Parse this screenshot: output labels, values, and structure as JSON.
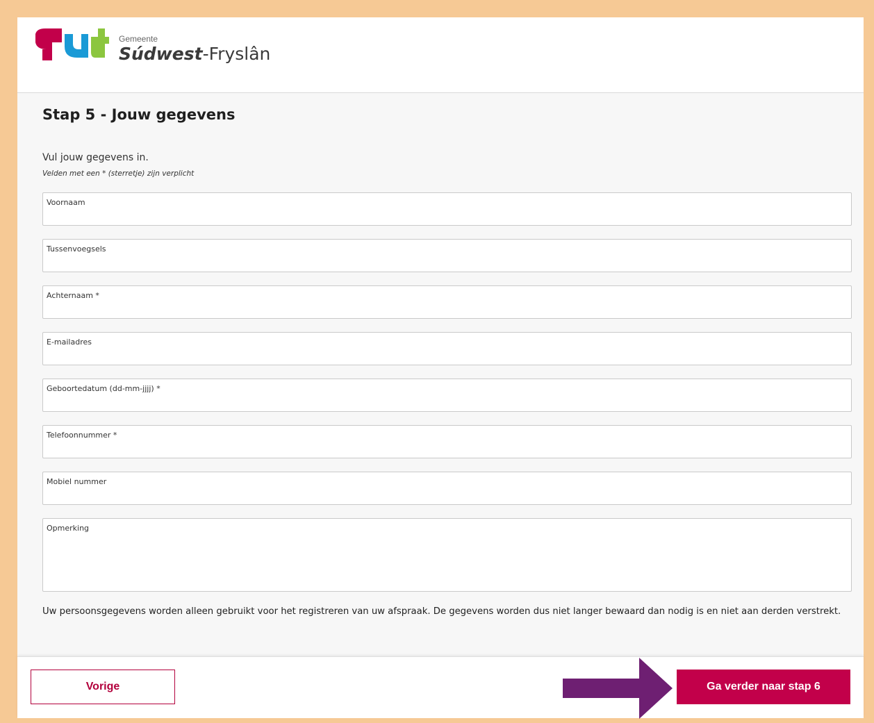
{
  "header": {
    "logo_small": "Gemeente",
    "logo_bold": "Súdwest",
    "logo_rest": "-Fryslân"
  },
  "main": {
    "title": "Stap 5 - Jouw gegevens",
    "intro": "Vul jouw gegevens in.",
    "hint": "Velden met een * (sterretje) zijn verplicht",
    "fields": [
      {
        "label": "Voornaam",
        "value": ""
      },
      {
        "label": "Tussenvoegsels",
        "value": ""
      },
      {
        "label": "Achternaam *",
        "value": ""
      },
      {
        "label": "E-mailadres",
        "value": ""
      },
      {
        "label": "Geboortedatum (dd-mm-jjjj) *",
        "value": ""
      },
      {
        "label": "Telefoonnummer *",
        "value": ""
      },
      {
        "label": "Mobiel nummer",
        "value": ""
      },
      {
        "label": "Opmerking",
        "value": ""
      }
    ],
    "privacy": "Uw persoonsgegevens worden alleen gebruikt voor het registreren van uw afspraak. De gegevens worden dus niet langer bewaard dan nodig is en niet aan derden verstrekt."
  },
  "footer": {
    "prev_label": "Vorige",
    "next_label": "Ga verder naar stap 6"
  },
  "colors": {
    "accent": "#c2004a",
    "frame": "#f6c995",
    "arrow": "#6e1f72"
  }
}
